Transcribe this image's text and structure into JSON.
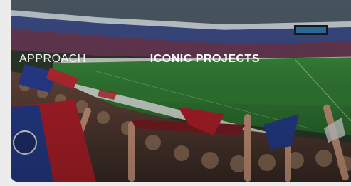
{
  "nav": {
    "items": [
      {
        "label": "APPROACH",
        "active": false
      },
      {
        "label": "ICONIC PROJECTS",
        "active": true
      }
    ]
  },
  "hero": {
    "image_subject": "stadium-crowd-waving-flags",
    "colors": {
      "sky": "#5f7f95",
      "pitch": "#2f7a34",
      "crowd_flags": "#b3202a",
      "flags_blue": "#253d8c",
      "backdrop": "#ececec"
    }
  }
}
